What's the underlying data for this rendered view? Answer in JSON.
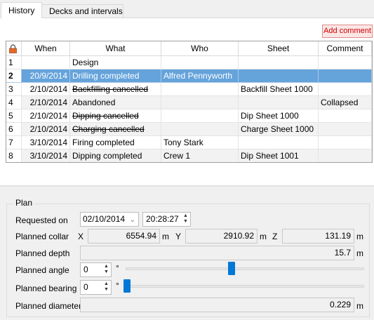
{
  "tabs": [
    {
      "label": "History",
      "active": true
    },
    {
      "label": "Decks and intervals",
      "active": false
    }
  ],
  "add_comment_label": "Add comment",
  "grid": {
    "columns": [
      "When",
      "What",
      "Who",
      "Sheet",
      "Comment"
    ],
    "rows": [
      {
        "num": "1",
        "when": "",
        "what": "Design",
        "who": "",
        "sheet": "",
        "comment": "",
        "strike": false
      },
      {
        "num": "2",
        "when": "20/9/2014",
        "what": "Drilling completed",
        "who": "Alfred Pennyworth",
        "sheet": "",
        "comment": "",
        "strike": false
      },
      {
        "num": "3",
        "when": "2/10/2014",
        "what": "Backfilling cancelled",
        "who": "",
        "sheet": "Backfill Sheet 1000",
        "comment": "",
        "strike": true
      },
      {
        "num": "4",
        "when": "2/10/2014",
        "what": "Abandoned",
        "who": "",
        "sheet": "",
        "comment": "Collapsed",
        "strike": false
      },
      {
        "num": "5",
        "when": "2/10/2014",
        "what": "Dipping cancelled",
        "who": "",
        "sheet": "Dip Sheet 1000",
        "comment": "",
        "strike": true
      },
      {
        "num": "6",
        "when": "2/10/2014",
        "what": "Charging cancelled",
        "who": "",
        "sheet": "Charge Sheet 1000",
        "comment": "",
        "strike": true
      },
      {
        "num": "7",
        "when": "3/10/2014",
        "what": "Firing completed",
        "who": "Tony Stark",
        "sheet": "",
        "comment": "",
        "strike": false
      },
      {
        "num": "8",
        "when": "3/10/2014",
        "what": "Dipping completed",
        "who": "Crew 1",
        "sheet": "Dip Sheet 1001",
        "comment": "",
        "strike": false
      }
    ]
  },
  "plan": {
    "legend": "Plan",
    "requested_on_label": "Requested on",
    "requested_date": "02/10/2014",
    "requested_time": "20:28:27",
    "collar_label": "Planned collar",
    "x_label": "X",
    "x_value": "6554.94",
    "y_label": "Y",
    "y_value": "2910.92",
    "z_label": "Z",
    "z_value": "131.19",
    "unit_m": "m",
    "depth_label": "Planned depth",
    "depth_value": "15.7",
    "angle_label": "Planned angle",
    "angle_value": "0",
    "angle_slider_fraction": 0.45,
    "bearing_label": "Planned bearing",
    "bearing_value": "0",
    "bearing_slider_fraction": 0.0,
    "degree_symbol": "°",
    "diameter_label": "Planned diameter",
    "diameter_value": "0.229"
  },
  "colors": {
    "selection": "#65a3db",
    "add_comment_text": "#d10000"
  }
}
